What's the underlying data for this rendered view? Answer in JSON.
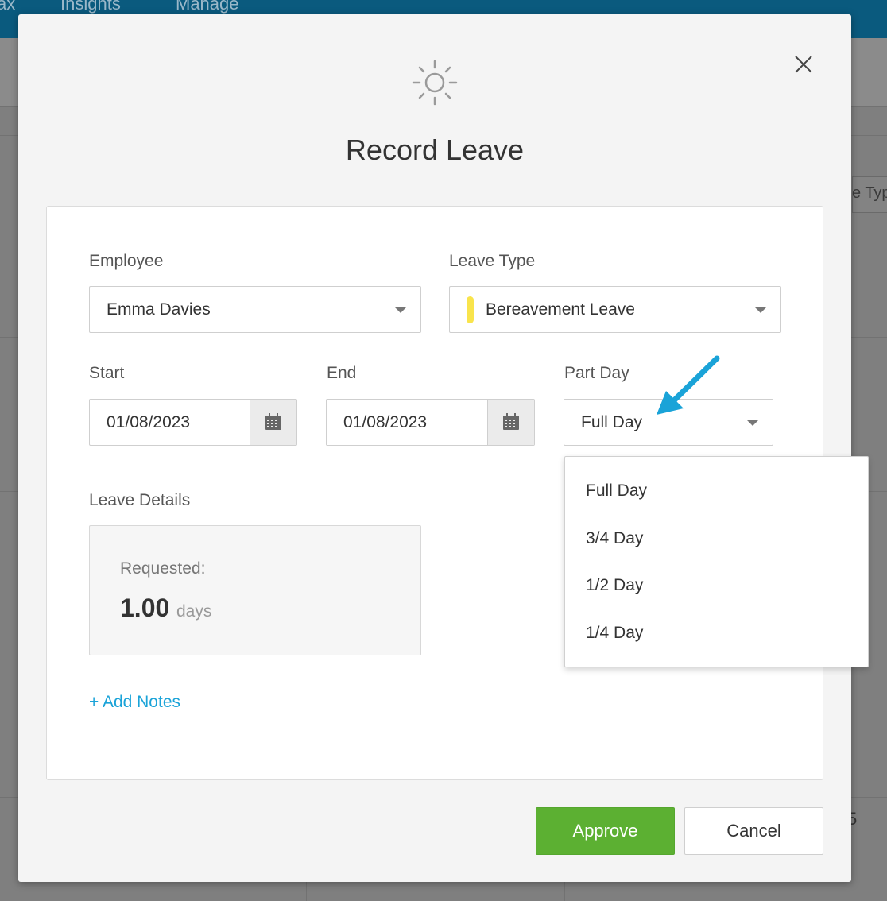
{
  "background": {
    "nav_items": [
      "ax",
      "Insights",
      "Manage"
    ],
    "partial_column_header": "e Typ",
    "partial_digit": "5"
  },
  "modal": {
    "title": "Record Leave",
    "header_icon": "sun-icon",
    "close_icon": "close-icon"
  },
  "form": {
    "employee": {
      "label": "Employee",
      "value": "Emma Davies"
    },
    "leave_type": {
      "label": "Leave Type",
      "value": "Bereavement Leave",
      "color": "#f9e44c"
    },
    "start": {
      "label": "Start",
      "value": "01/08/2023"
    },
    "end": {
      "label": "End",
      "value": "01/08/2023"
    },
    "part_day": {
      "label": "Part Day",
      "value": "Full Day",
      "options": [
        "Full Day",
        "3/4 Day",
        "1/2 Day",
        "1/4 Day"
      ]
    },
    "leave_details": {
      "label": "Leave Details",
      "requested_label": "Requested:",
      "requested_value": "1.00",
      "requested_unit": "days"
    },
    "add_notes": "+ Add Notes"
  },
  "actions": {
    "approve": "Approve",
    "cancel": "Cancel"
  },
  "colors": {
    "approve": "#5cb032",
    "link": "#1aa3d8",
    "annotation_arrow": "#1aa3d8",
    "topbar": "#0a5a7e"
  }
}
